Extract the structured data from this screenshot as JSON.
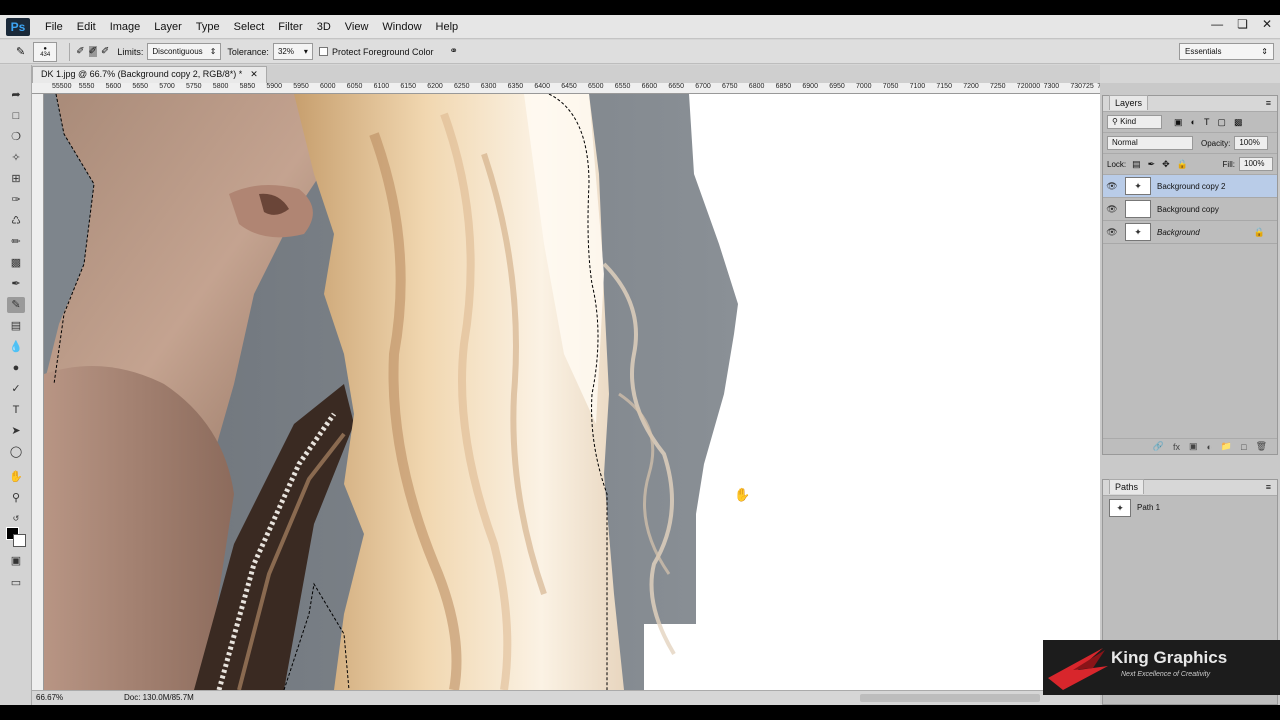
{
  "app": {
    "logo": "Ps"
  },
  "menu": [
    "File",
    "Edit",
    "Image",
    "Layer",
    "Type",
    "Select",
    "Filter",
    "3D",
    "View",
    "Window",
    "Help"
  ],
  "options_bar": {
    "brush_size": "434",
    "limits_label": "Limits:",
    "limits_value": "Discontiguous",
    "tolerance_label": "Tolerance:",
    "tolerance_value": "32%",
    "protect_fg_label": "Protect Foreground Color",
    "workspace": "Essentials"
  },
  "document": {
    "tab_title": "DK 1.jpg @ 66.7% (Background copy 2, RGB/8*) *",
    "ruler_labels": [
      "55500",
      "5550",
      "5600",
      "5650",
      "5700",
      "5750",
      "5800",
      "5850",
      "5900",
      "5950",
      "6000",
      "6050",
      "6100",
      "6150",
      "6200",
      "6250",
      "6300",
      "6350",
      "6400",
      "6450",
      "6500",
      "6550",
      "6600",
      "6650",
      "6700",
      "6750",
      "6800",
      "6850",
      "6900",
      "6950",
      "7000",
      "7050",
      "7100",
      "7150",
      "7200",
      "7250",
      "720000",
      "7300",
      "730725",
      "7350"
    ]
  },
  "status": {
    "zoom": "66.67%",
    "doc_size": "Doc: 130.0M/85.7M"
  },
  "layers_panel": {
    "title": "Layers",
    "kind": "Kind",
    "blend_mode": "Normal",
    "opacity_label": "Opacity:",
    "opacity_value": "100%",
    "lock_label": "Lock:",
    "fill_label": "Fill:",
    "fill_value": "100%",
    "layers": [
      {
        "name": "Background copy 2",
        "selected": true
      },
      {
        "name": "Background copy",
        "selected": false
      },
      {
        "name": "Background",
        "selected": false
      }
    ]
  },
  "paths_panel": {
    "title": "Paths",
    "paths": [
      {
        "name": "Path 1"
      }
    ]
  },
  "watermark": {
    "title": "King Graphics",
    "subtitle": "Next Excellence of Creativity"
  },
  "colors": {
    "foreground": "#000000",
    "background": "#ffffff",
    "selected_layer": "#b9cce8"
  }
}
